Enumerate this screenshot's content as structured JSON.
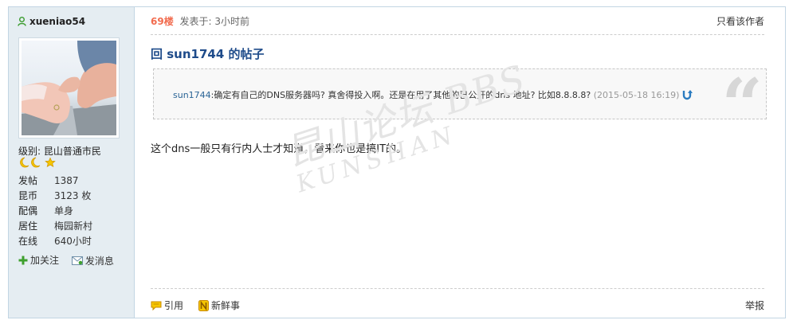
{
  "user": {
    "name": "xueniao54",
    "level_label": "级别:",
    "level_value": "昆山普通市民",
    "stats": [
      {
        "label": "发帖",
        "value": "1387"
      },
      {
        "label": "昆币",
        "value": "3123 枚"
      },
      {
        "label": "配偶",
        "value": "单身"
      },
      {
        "label": "居住",
        "value": "梅园新村"
      },
      {
        "label": "在线",
        "value": "640小时"
      }
    ],
    "follow_label": "加关注",
    "message_label": "发消息"
  },
  "post": {
    "floor": "69楼",
    "posted": "发表于: 3小时前",
    "only_author": "只看该作者",
    "title": "回 sun1744 的帖子",
    "quote_user": "sun1744",
    "quote_text": ":确定有自己的DNS服务器吗? 真舍得投入啊。还是在用了其他的已公开的dns 地址? 比如8.8.8.8?",
    "quote_time": "(2015-05-18 16:19)",
    "body": "这个dns一般只有行内人士才知道，看来你也是搞IT的。",
    "watermark_top": "昆山论坛 BBS",
    "watermark_bottom": "KUNSHAN"
  },
  "footer": {
    "quote_label": "引用",
    "fresh_label": "新鲜事",
    "report_label": "举报"
  },
  "colors": {
    "sidebar_bg": "#e5edf2",
    "border": "#c2d5e3",
    "floor": "#f26c4f",
    "title": "#1e4b8a"
  }
}
